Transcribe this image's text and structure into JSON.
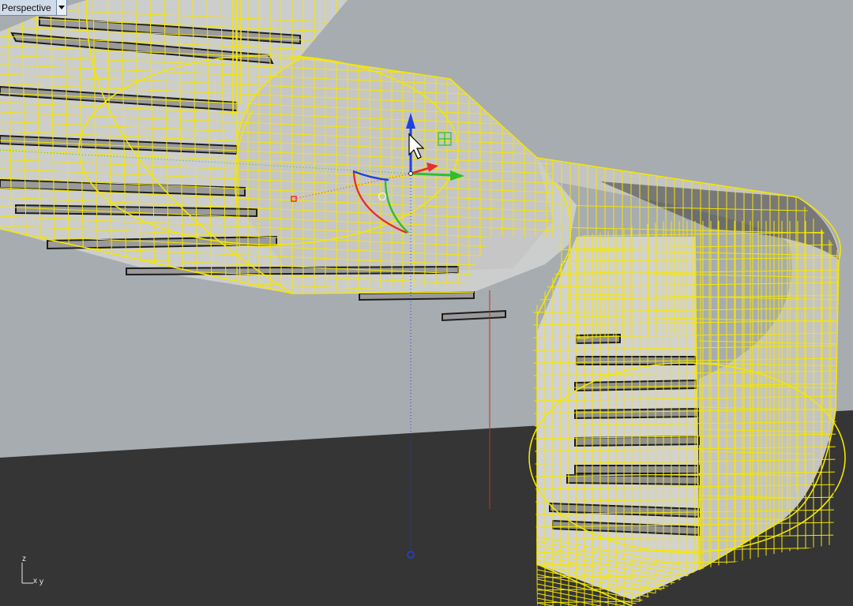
{
  "viewport": {
    "title": "Perspective",
    "menu_icon": "triangle-down-icon"
  },
  "axis_icon": {
    "z": "z",
    "x": "x",
    "y": "y"
  },
  "colors": {
    "background": "#a6abb0",
    "floor": "#353535",
    "wireframe": "#f4e600",
    "surface": "#c9c9c9",
    "gizmo_x": "#e8302a",
    "gizmo_y": "#2fbe2f",
    "gizmo_z": "#1f3fe6"
  },
  "gizmo": {
    "name": "gumball",
    "axes": [
      "x",
      "y",
      "z"
    ]
  }
}
